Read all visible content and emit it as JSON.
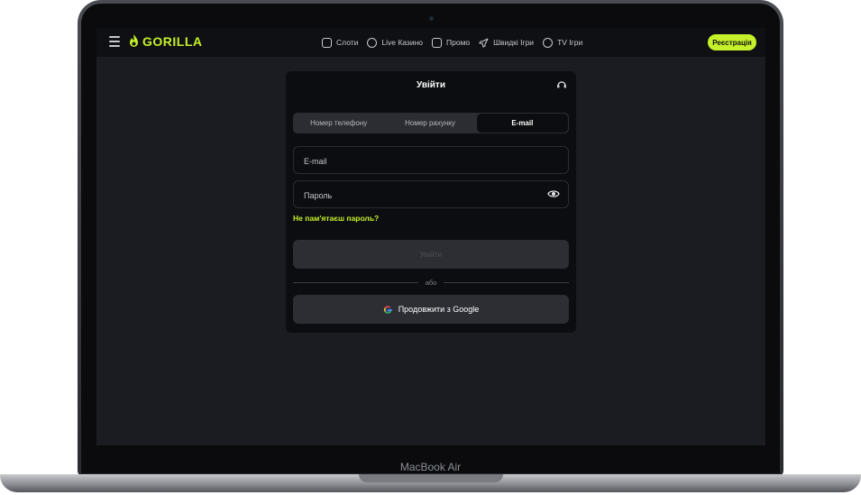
{
  "device": {
    "label": "MacBook Air"
  },
  "header": {
    "logo_text": "GORILLA",
    "register_label": "Реєстрація",
    "nav": [
      {
        "label": "Слоти",
        "icon": "slots-icon"
      },
      {
        "label": "Live Казино",
        "icon": "live-casino-icon"
      },
      {
        "label": "Промо",
        "icon": "gift-icon"
      },
      {
        "label": "Швидкі Ігри",
        "icon": "rocket-icon"
      },
      {
        "label": "TV Ігри",
        "icon": "tv-games-icon"
      }
    ]
  },
  "login": {
    "title": "Увійти",
    "tabs": [
      {
        "label": "Номер телефону"
      },
      {
        "label": "Номер рахунку"
      },
      {
        "label": "E-mail"
      }
    ],
    "email_placeholder": "E-mail",
    "password_placeholder": "Пароль",
    "forgot_label": "Не пам'ятаєш пароль?",
    "submit_label": "Увійти",
    "divider_label": "або",
    "google_label": "Продовжити з Google"
  },
  "colors": {
    "accent": "#c5f02a",
    "background": "#1b1c22",
    "panel": "#0c0d10"
  }
}
